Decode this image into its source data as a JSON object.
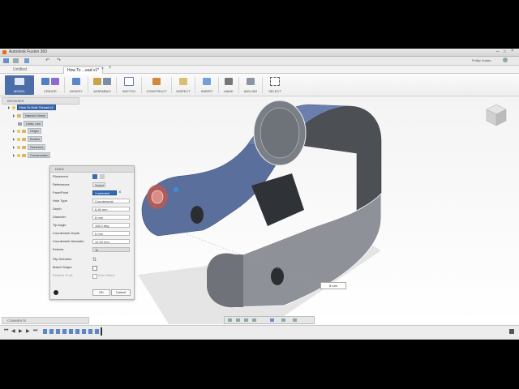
{
  "window": {
    "title": "Autodesk Fusion 360",
    "user": "Phillip Dufats"
  },
  "tabs": {
    "untitled": "Untitled",
    "active": "How To ...ead v1*"
  },
  "ribbon": {
    "workspace": "MODEL",
    "groups": [
      "CREATE",
      "MODIFY",
      "ASSEMBLE",
      "SKETCH",
      "CONSTRUCT",
      "INSPECT",
      "INSERT",
      "MAKE",
      "ADD-INS",
      "SELECT"
    ]
  },
  "browser": {
    "header": "BROWSER",
    "root": "How To Hole Thread v1",
    "items": [
      "Named Views",
      "Units: mm",
      "Origin",
      "Bodies",
      "Sketches",
      "Construction"
    ]
  },
  "dialog": {
    "title": "HOLE",
    "rows": [
      {
        "label": "Placement",
        "value": ""
      },
      {
        "label": "References",
        "value": "Select"
      },
      {
        "label": "Face/Point",
        "value": "1 selected"
      },
      {
        "label": "Hole Type",
        "value": "Countersunk"
      },
      {
        "label": "Depth",
        "value": "8.46 mm"
      },
      {
        "label": "Diameter",
        "value": "8 mm"
      },
      {
        "label": "Tip Angle",
        "value": "118.0 deg"
      },
      {
        "label": "Countersink Depth",
        "value": "6 mm"
      },
      {
        "label": "Countersink Diameter",
        "value": "12.00 mm"
      },
      {
        "label": "Extents",
        "value": "To"
      },
      {
        "label": "Flip Direction",
        "value": ""
      },
      {
        "label": "Match Shape",
        "value": ""
      },
      {
        "label": "Related To All",
        "value": "Auto Select"
      }
    ],
    "ok": "OK",
    "cancel": "Cancel"
  },
  "comments": "COMMENTS",
  "dimension": "8 mm",
  "colors": {
    "accent": "#2f6db5",
    "body": "#8a8e94",
    "selected_body": "#4a5f88"
  }
}
